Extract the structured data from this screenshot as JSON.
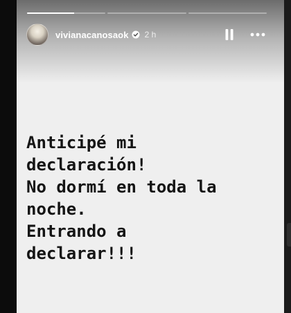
{
  "story": {
    "progress": [
      {
        "fill": 0.6
      },
      {
        "fill": 0
      },
      {
        "fill": 0
      }
    ],
    "author": {
      "username": "vivianacanosaok",
      "verified": true,
      "time": "2 h"
    },
    "controls": {
      "pause_icon": "pause-icon",
      "more_icon": "more-horizontal-icon"
    },
    "text": "Anticipé mi\ndeclaración!\nNo dormí en toda la\nnoche.\nEntrando a\ndeclarar!!!"
  },
  "colors": {
    "background": "#0c0c0c",
    "story_bg": "#efefef",
    "text": "#151515"
  }
}
